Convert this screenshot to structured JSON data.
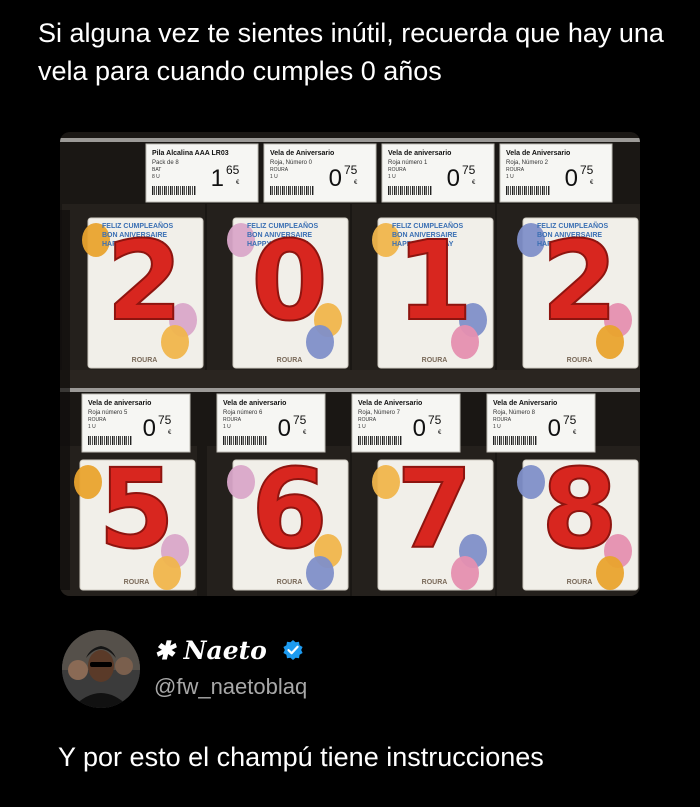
{
  "post": {
    "caption": "Si alguna vez te sientes inútil, recuerda que hay una vela para cuando cumples 0 años",
    "tweet_text": "Y por esto el champú tiene instrucciones"
  },
  "author": {
    "display_name": "✱ Naeto",
    "handle": "@fw_naetoblaq",
    "verified": true
  },
  "colors": {
    "background": "#000000",
    "handle": "#a8a8a8",
    "verified_badge": "#1d9bf0",
    "candle_red": "#d8261f"
  },
  "photo": {
    "top_shelf": {
      "labels": [
        {
          "title": "Pila Alcalina AAA LR03",
          "line1": "Pack de 8",
          "line2": "BAT",
          "line3": "8 U",
          "price_int": "1",
          "price_dec": "65"
        },
        {
          "title": "Vela de Aniversario",
          "line1": "Roja, Número 0",
          "line2": "ROURA",
          "line3": "1 U",
          "price_int": "0",
          "price_dec": "75"
        },
        {
          "title": "Vela de aniversario",
          "line1": "Roja número 1",
          "line2": "ROURA",
          "line3": "1 U",
          "price_int": "0",
          "price_dec": "75"
        },
        {
          "title": "Vela de Aniversario",
          "line1": "Roja, Número 2",
          "line2": "ROURA",
          "line3": "1 U",
          "price_int": "0",
          "price_dec": "75"
        }
      ],
      "digits": [
        "2",
        "0",
        "1",
        "2"
      ],
      "package_text": "FELIZ CUMPLEAÑOS · BON ANIVERSAIRE · HAPPY BIRTHDAY",
      "brand": "ROURA"
    },
    "bottom_shelf": {
      "labels": [
        {
          "title": "Vela de aniversario",
          "line1": "Roja número 5",
          "line2": "ROURA",
          "line3": "1 U",
          "price_int": "0",
          "price_dec": "75"
        },
        {
          "title": "Vela de aniversario",
          "line1": "Roja número 6",
          "line2": "ROURA",
          "line3": "1 U",
          "price_int": "0",
          "price_dec": "75"
        },
        {
          "title": "Vela de Aniversario",
          "line1": "Roja, Número 7",
          "line2": "ROURA",
          "line3": "1 U",
          "price_int": "0",
          "price_dec": "75"
        },
        {
          "title": "Vela de Aniversario",
          "line1": "Roja, Número 8",
          "line2": "ROURA",
          "line3": "1 U",
          "price_int": "0",
          "price_dec": "75"
        }
      ],
      "digits": [
        "5",
        "6",
        "7",
        "8"
      ],
      "brand": "ROURA"
    }
  }
}
